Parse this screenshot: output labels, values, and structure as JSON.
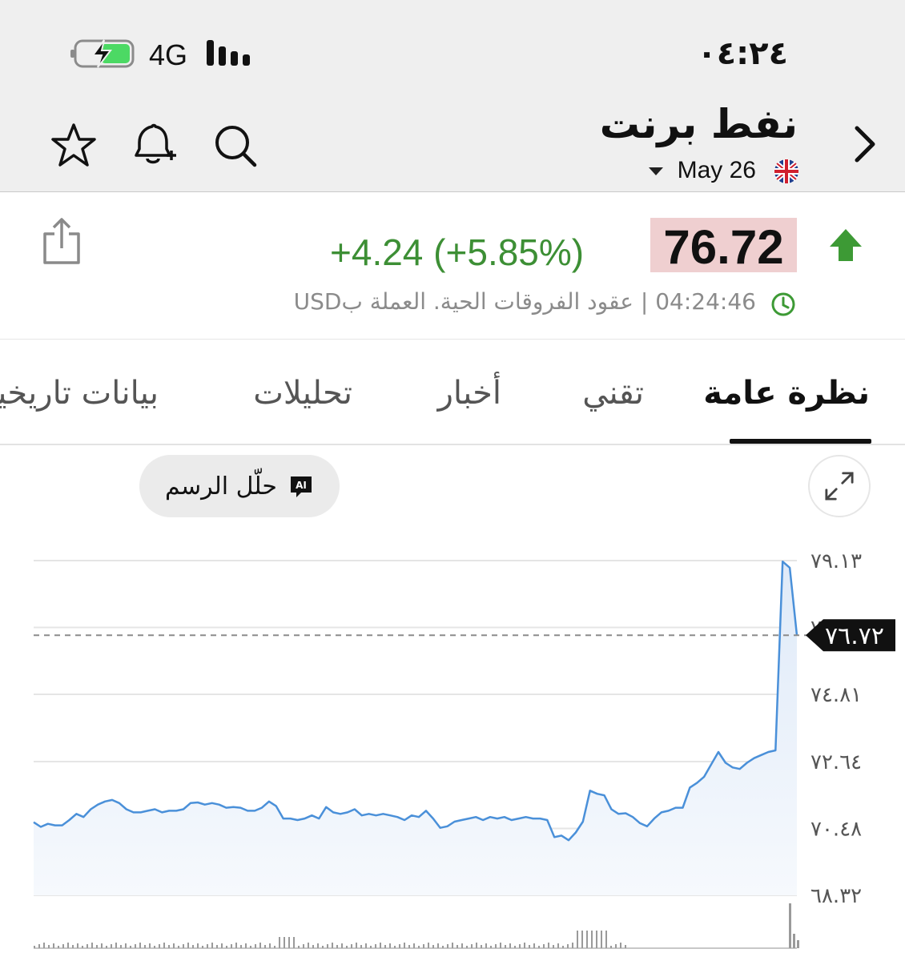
{
  "status_bar": {
    "time": "٠٤:٢٤",
    "network": "4G"
  },
  "header": {
    "title": "نفط برنت",
    "contract": "May 26",
    "icons": [
      "chevron-right-icon",
      "uk-flag-icon",
      "caret-down-icon",
      "search-icon",
      "bell-plus-icon",
      "star-icon"
    ]
  },
  "quote": {
    "price": "76.72",
    "change": "+4.24 (+5.85%)",
    "timestamp": "04:24:46",
    "separator": "|",
    "description": "عقود الفروقات الحية. العملة بUSD",
    "colors": {
      "positive": "#3d8f35",
      "price_highlight": "#efcfd0"
    }
  },
  "tabs": [
    {
      "label": "نظرة عامة",
      "active": true
    },
    {
      "label": "تقني",
      "active": false
    },
    {
      "label": "أخبار",
      "active": false
    },
    {
      "label": "تحليلات",
      "active": false
    },
    {
      "label": "بيانات تاريخية",
      "active": false
    }
  ],
  "chart_toolbar": {
    "ai_badge": "AI",
    "ai_button": "حلّل الرسم"
  },
  "chart_data": {
    "type": "area",
    "y_ticks": [
      "٧٩.١٣",
      "٧٦.٩٧",
      "٧٤.٨١",
      "٧٢.٦٤",
      "٧٠.٤٨",
      "٦٨.٣٢"
    ],
    "y_tick_values": [
      79.13,
      76.97,
      74.81,
      72.64,
      70.48,
      68.32
    ],
    "ylim": [
      68.32,
      79.13
    ],
    "current_price_label": "٧٦.٧٢",
    "current_price": 76.72,
    "line_color": "#4a90d9",
    "values": [
      70.68,
      70.53,
      70.63,
      70.58,
      70.58,
      70.75,
      70.95,
      70.85,
      71.1,
      71.25,
      71.35,
      71.4,
      71.3,
      71.1,
      71.0,
      71.0,
      71.05,
      71.1,
      71.0,
      71.05,
      71.05,
      71.1,
      71.3,
      71.32,
      71.25,
      71.3,
      71.25,
      71.15,
      71.17,
      71.15,
      71.05,
      71.05,
      71.15,
      71.35,
      71.2,
      70.8,
      70.8,
      70.75,
      70.8,
      70.9,
      70.8,
      71.17,
      71.0,
      70.95,
      71.0,
      71.1,
      70.9,
      70.95,
      70.9,
      70.95,
      70.9,
      70.85,
      70.75,
      70.9,
      70.85,
      71.05,
      70.8,
      70.5,
      70.55,
      70.7,
      70.75,
      70.8,
      70.85,
      70.75,
      70.85,
      70.8,
      70.85,
      70.75,
      70.8,
      70.85,
      70.8,
      70.8,
      70.75,
      70.2,
      70.25,
      70.1,
      70.35,
      70.7,
      71.7,
      71.6,
      71.55,
      71.1,
      70.95,
      70.97,
      70.85,
      70.65,
      70.55,
      70.8,
      71.0,
      71.05,
      71.15,
      71.15,
      71.8,
      71.95,
      72.15,
      72.55,
      72.95,
      72.6,
      72.45,
      72.4,
      72.6,
      72.75,
      72.85,
      72.95,
      73.0,
      79.1,
      78.9,
      76.72
    ]
  }
}
